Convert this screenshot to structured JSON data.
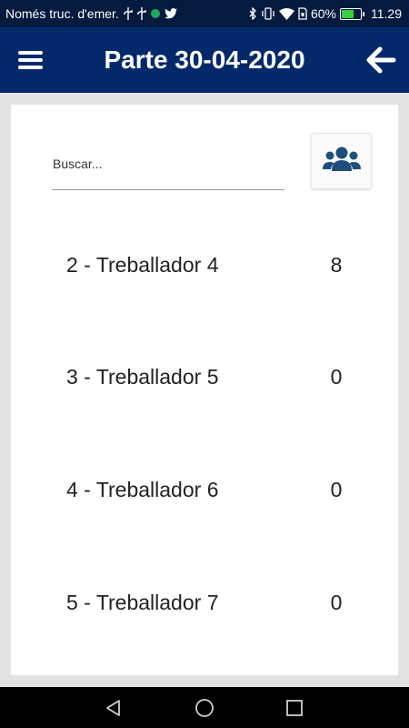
{
  "status_bar": {
    "carrier_text": "Només truc. d'emer.",
    "battery_percent": "60%",
    "battery_level": 0.6,
    "time": "11.29",
    "icons": [
      "usb-icon",
      "usb-icon",
      "green-dot-icon",
      "twitter-icon",
      "bluetooth-icon",
      "vibrate-icon",
      "wifi-icon",
      "sim-icon",
      "battery-icon"
    ]
  },
  "app_bar": {
    "title": "Parte 30-04-2020",
    "menu_icon": "hamburger-menu-icon",
    "back_icon": "arrow-left-icon"
  },
  "search": {
    "placeholder": "Buscar...",
    "value": ""
  },
  "group_button": {
    "icon": "users-group-icon"
  },
  "workers": [
    {
      "name": "2 - Treballador 4",
      "count": "8"
    },
    {
      "name": "3 - Treballador 5",
      "count": "0"
    },
    {
      "name": "4 - Treballador 6",
      "count": "0"
    },
    {
      "name": "5 - Treballador 7",
      "count": "0"
    }
  ],
  "colors": {
    "status_bar_bg": "#041a3f",
    "app_bar_bg": "#04296b",
    "icon_accent": "#1d4f7a",
    "page_bg": "#e3e3e3"
  }
}
